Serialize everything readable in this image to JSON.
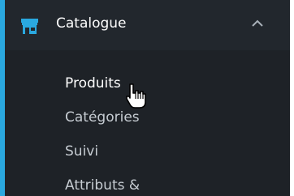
{
  "menu": {
    "header": {
      "icon": "store-icon",
      "label": "Catalogue",
      "toggle_icon": "chevron-up-icon"
    },
    "items": [
      {
        "label": "Produits",
        "state": "hovered"
      },
      {
        "label": "Catégories",
        "state": "normal"
      },
      {
        "label": "Suivi",
        "state": "normal"
      },
      {
        "label": "Attributs &",
        "state": "normal"
      }
    ]
  },
  "cursor": {
    "icon": "hand-pointer-icon"
  },
  "colors": {
    "sidebar_bg": "#1e2227",
    "header_bg": "#22272d",
    "accent": "#2aa8df",
    "text_active": "#ffffff",
    "text_muted": "#c6ccd2"
  }
}
